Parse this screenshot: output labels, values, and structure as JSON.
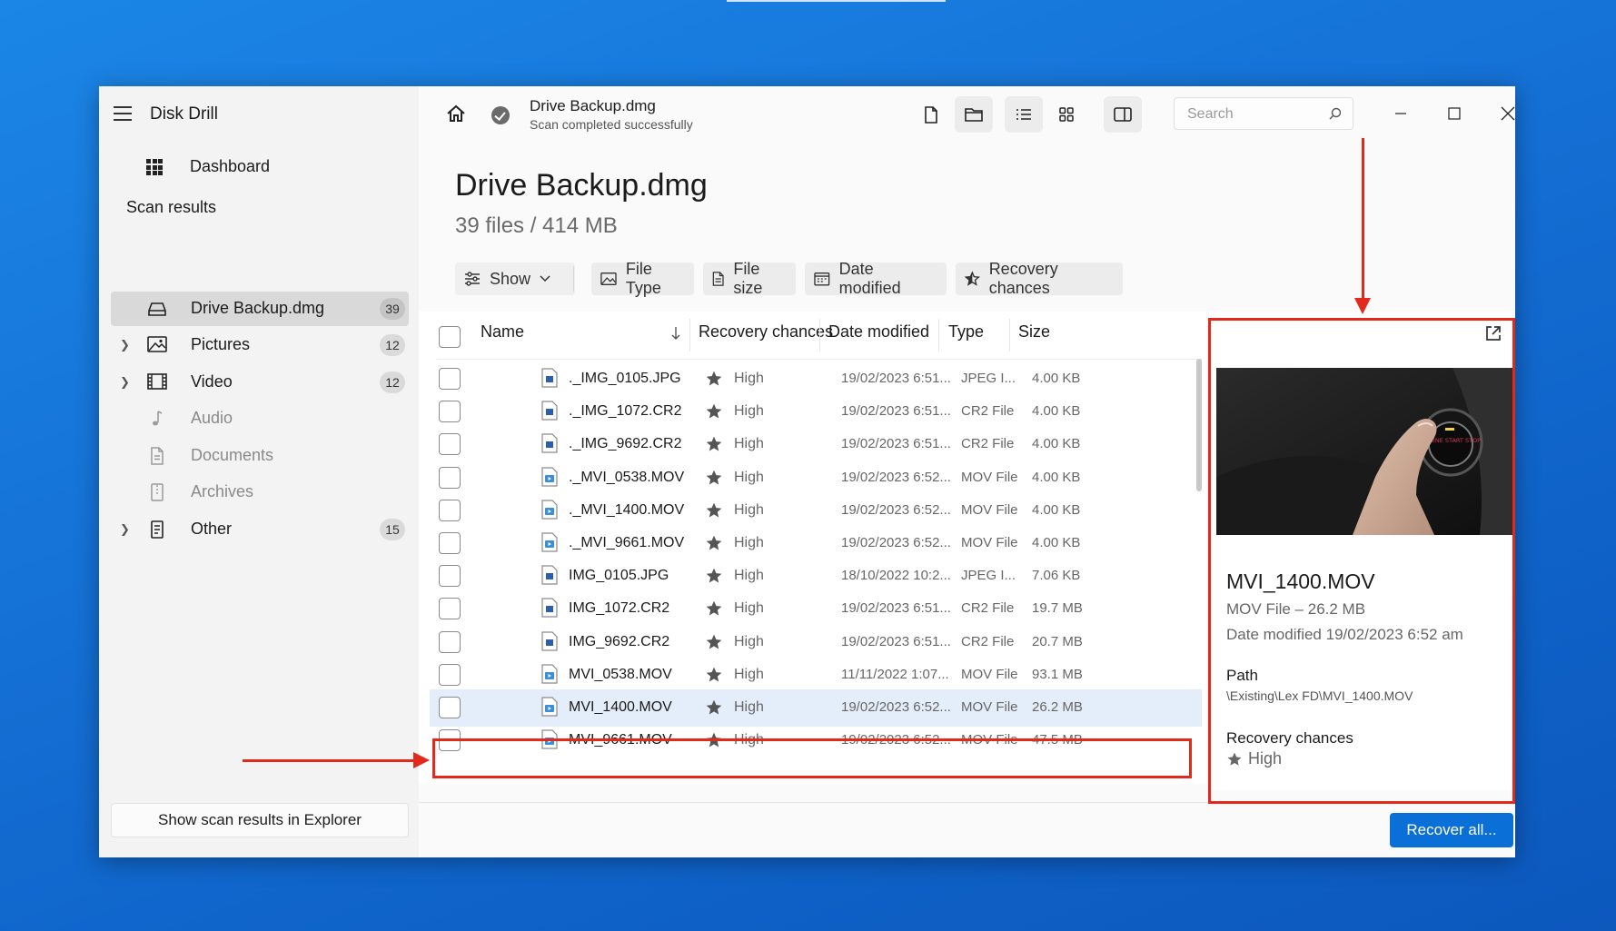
{
  "app": {
    "title": "Disk Drill"
  },
  "sidebar": {
    "dashboard_label": "Dashboard",
    "section_title": "Scan results",
    "items": [
      {
        "label": "Drive Backup.dmg",
        "count": "39",
        "icon": "drive-icon",
        "active": true,
        "expandable": false
      },
      {
        "label": "Pictures",
        "count": "12",
        "icon": "picture-icon",
        "expandable": true
      },
      {
        "label": "Video",
        "count": "12",
        "icon": "film-icon",
        "expandable": true
      },
      {
        "label": "Audio",
        "count": "",
        "icon": "music-note-icon",
        "expandable": false,
        "dimmed": true
      },
      {
        "label": "Documents",
        "count": "",
        "icon": "document-icon",
        "expandable": false,
        "dimmed": true
      },
      {
        "label": "Archives",
        "count": "",
        "icon": "archive-icon",
        "expandable": false,
        "dimmed": true
      },
      {
        "label": "Other",
        "count": "15",
        "icon": "file-icon",
        "expandable": true
      }
    ],
    "explorer_button": "Show scan results in Explorer"
  },
  "toolbar": {
    "title": "Drive Backup.dmg",
    "subtitle": "Scan completed successfully",
    "search_placeholder": "Search",
    "status_icon": "check-circle-icon"
  },
  "main": {
    "title": "Drive Backup.dmg",
    "subtitle": "39 files / 414 MB",
    "filters": {
      "show": "Show",
      "file_type": "File Type",
      "file_size": "File size",
      "date_modified": "Date modified",
      "recovery_chances": "Recovery chances"
    }
  },
  "table": {
    "headers": {
      "name": "Name",
      "recovery": "Recovery chances",
      "date": "Date modified",
      "type": "Type",
      "size": "Size"
    },
    "rows": [
      {
        "name": "._IMG_0105.JPG",
        "recovery": "High",
        "date": "19/02/2023 6:51...",
        "type": "JPEG I...",
        "size": "4.00 KB",
        "kind": "image"
      },
      {
        "name": "._IMG_1072.CR2",
        "recovery": "High",
        "date": "19/02/2023 6:51...",
        "type": "CR2 File",
        "size": "4.00 KB",
        "kind": "image"
      },
      {
        "name": "._IMG_9692.CR2",
        "recovery": "High",
        "date": "19/02/2023 6:51...",
        "type": "CR2 File",
        "size": "4.00 KB",
        "kind": "image"
      },
      {
        "name": "._MVI_0538.MOV",
        "recovery": "High",
        "date": "19/02/2023 6:52...",
        "type": "MOV File",
        "size": "4.00 KB",
        "kind": "video"
      },
      {
        "name": "._MVI_1400.MOV",
        "recovery": "High",
        "date": "19/02/2023 6:52...",
        "type": "MOV File",
        "size": "4.00 KB",
        "kind": "video"
      },
      {
        "name": "._MVI_9661.MOV",
        "recovery": "High",
        "date": "19/02/2023 6:52...",
        "type": "MOV File",
        "size": "4.00 KB",
        "kind": "video"
      },
      {
        "name": "IMG_0105.JPG",
        "recovery": "High",
        "date": "18/10/2022 10:2...",
        "type": "JPEG I...",
        "size": "7.06 KB",
        "kind": "image"
      },
      {
        "name": "IMG_1072.CR2",
        "recovery": "High",
        "date": "19/02/2023 6:51...",
        "type": "CR2 File",
        "size": "19.7 MB",
        "kind": "image"
      },
      {
        "name": "IMG_9692.CR2",
        "recovery": "High",
        "date": "19/02/2023 6:51...",
        "type": "CR2 File",
        "size": "20.7 MB",
        "kind": "image"
      },
      {
        "name": "MVI_0538.MOV",
        "recovery": "High",
        "date": "11/11/2022 1:07...",
        "type": "MOV File",
        "size": "93.1 MB",
        "kind": "video"
      },
      {
        "name": "MVI_1400.MOV",
        "recovery": "High",
        "date": "19/02/2023 6:52...",
        "type": "MOV File",
        "size": "26.2 MB",
        "kind": "video",
        "selected": true
      },
      {
        "name": "MVI_9661.MOV",
        "recovery": "High",
        "date": "19/02/2023 6:52...",
        "type": "MOV File",
        "size": "47.5 MB",
        "kind": "video"
      }
    ]
  },
  "details": {
    "file_name": "MVI_1400.MOV",
    "type_size": "MOV File – 26.2 MB",
    "date_modified": "Date modified 19/02/2023 6:52 am",
    "path_label": "Path",
    "path": "\\Existing\\Lex FD\\MVI_1400.MOV",
    "recovery_label": "Recovery chances",
    "recovery_value": "High",
    "preview_sign_text": "ENGINE START STOP"
  },
  "footer": {
    "recover_button": "Recover all..."
  },
  "colors": {
    "accent": "#0a6fd6",
    "annotation": "#e2291b",
    "selected_row": "#e3eefa"
  }
}
